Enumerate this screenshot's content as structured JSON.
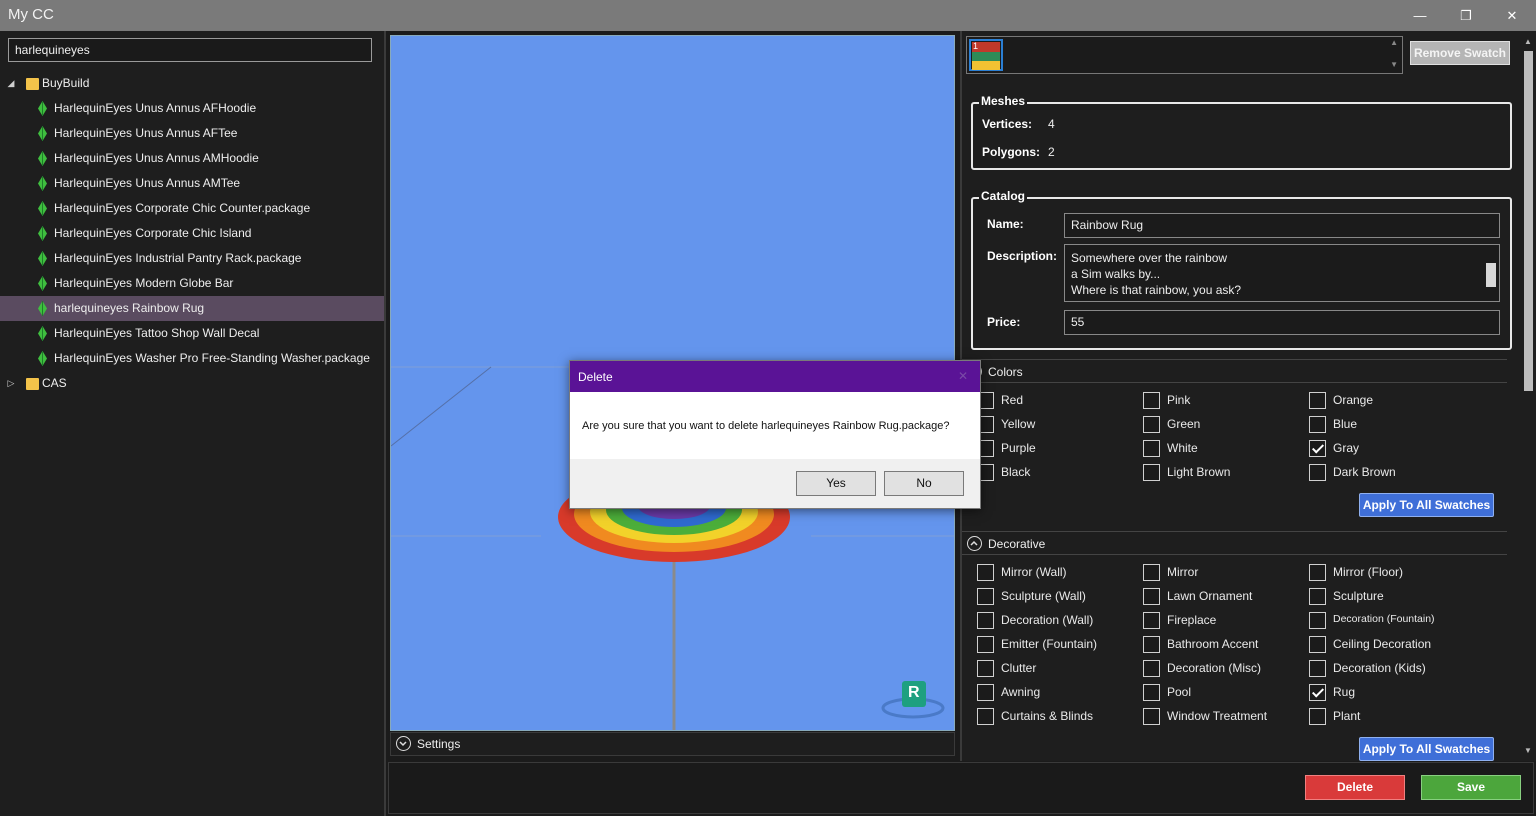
{
  "window": {
    "title": "My CC",
    "minimize": "—",
    "restore": "❐",
    "close": "✕"
  },
  "search": {
    "value": "harlequineyes"
  },
  "tree": {
    "folders": [
      {
        "label": "BuyBuild",
        "expander": "◢"
      },
      {
        "label": "CAS",
        "expander": "▷"
      }
    ],
    "items": [
      "HarlequinEyes  Unus Annus AFHoodie",
      "HarlequinEyes  Unus Annus AFTee",
      "HarlequinEyes  Unus Annus AMHoodie",
      "HarlequinEyes  Unus Annus AMTee",
      "HarlequinEyes Corporate Chic Counter.package",
      "HarlequinEyes Corporate Chic Island",
      "HarlequinEyes Industrial Pantry Rack.package",
      "HarlequinEyes Modern Globe Bar",
      "harlequineyes Rainbow Rug",
      "HarlequinEyes Tattoo Shop Wall Decal",
      "HarlequinEyes Washer Pro Free-Standing Washer.package"
    ],
    "selected_index": 8
  },
  "viewport": {
    "background": "#6495ed",
    "badge": "R",
    "settings_label": "Settings"
  },
  "swatch": {
    "number": "1",
    "remove_label": "Remove Swatch"
  },
  "meshes": {
    "legend": "Meshes",
    "vertices_label": "Vertices:",
    "vertices": "4",
    "polygons_label": "Polygons:",
    "polygons": "2"
  },
  "catalog": {
    "legend": "Catalog",
    "name_label": "Name:",
    "name": "Rainbow Rug",
    "description_label": "Description:",
    "description_lines": [
      "Somewhere over the rainbow",
      "a Sim walks by...",
      "Where is that rainbow, you ask?"
    ],
    "price_label": "Price:",
    "price": "55"
  },
  "colors": {
    "header": "Colors",
    "options": [
      {
        "label": "Red",
        "checked": false
      },
      {
        "label": "Pink",
        "checked": false
      },
      {
        "label": "Orange",
        "checked": false
      },
      {
        "label": "Yellow",
        "checked": false
      },
      {
        "label": "Green",
        "checked": false
      },
      {
        "label": "Blue",
        "checked": false
      },
      {
        "label": "Purple",
        "checked": false
      },
      {
        "label": "White",
        "checked": false
      },
      {
        "label": "Gray",
        "checked": true
      },
      {
        "label": "Black",
        "checked": false
      },
      {
        "label": "Light Brown",
        "checked": false
      },
      {
        "label": "Dark Brown",
        "checked": false
      }
    ],
    "apply_label": "Apply To All Swatches"
  },
  "decorative": {
    "header": "Decorative",
    "options": [
      {
        "label": "Mirror (Wall)",
        "checked": false
      },
      {
        "label": "Mirror",
        "checked": false
      },
      {
        "label": "Mirror (Floor)",
        "checked": false
      },
      {
        "label": "Sculpture (Wall)",
        "checked": false
      },
      {
        "label": "Lawn Ornament",
        "checked": false
      },
      {
        "label": "Sculpture",
        "checked": false
      },
      {
        "label": "Decoration (Wall)",
        "checked": false
      },
      {
        "label": "Fireplace",
        "checked": false
      },
      {
        "label": "Decoration (Fountain)",
        "checked": false
      },
      {
        "label": "Emitter (Fountain)",
        "checked": false
      },
      {
        "label": "Bathroom Accent",
        "checked": false
      },
      {
        "label": "Ceiling Decoration",
        "checked": false
      },
      {
        "label": "Clutter",
        "checked": false
      },
      {
        "label": "Decoration (Misc)",
        "checked": false
      },
      {
        "label": "Decoration (Kids)",
        "checked": false
      },
      {
        "label": "Awning",
        "checked": false
      },
      {
        "label": "Pool",
        "checked": false
      },
      {
        "label": "Rug",
        "checked": true
      },
      {
        "label": "Curtains & Blinds",
        "checked": false
      },
      {
        "label": "Window Treatment",
        "checked": false
      },
      {
        "label": "Plant",
        "checked": false
      }
    ],
    "apply_label": "Apply To All Swatches"
  },
  "dialog": {
    "title": "Delete",
    "close": "✕",
    "message": "Are you sure that you want to delete harlequineyes Rainbow Rug.package?",
    "yes": "Yes",
    "no": "No"
  },
  "actions": {
    "delete": "Delete",
    "save": "Save"
  },
  "colors_theme": {
    "selected_row": "#5a4b60",
    "dialog_title": "#5a1396",
    "delete": "#d93a3a",
    "save": "#4ca63c",
    "apply": "#3f6fd8"
  }
}
